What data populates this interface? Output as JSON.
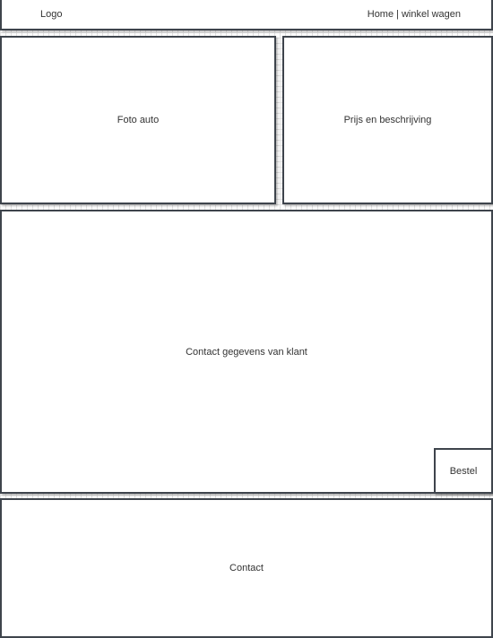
{
  "header": {
    "logo": "Logo",
    "nav_home": "Home",
    "nav_separator": "|",
    "nav_cart": "winkel wagen"
  },
  "photo": {
    "label": "Foto auto"
  },
  "price": {
    "label": "Prijs en beschrijving"
  },
  "customer": {
    "label": "Contact gegevens van klant"
  },
  "order": {
    "label": "Bestel"
  },
  "footer": {
    "label": "Contact"
  }
}
